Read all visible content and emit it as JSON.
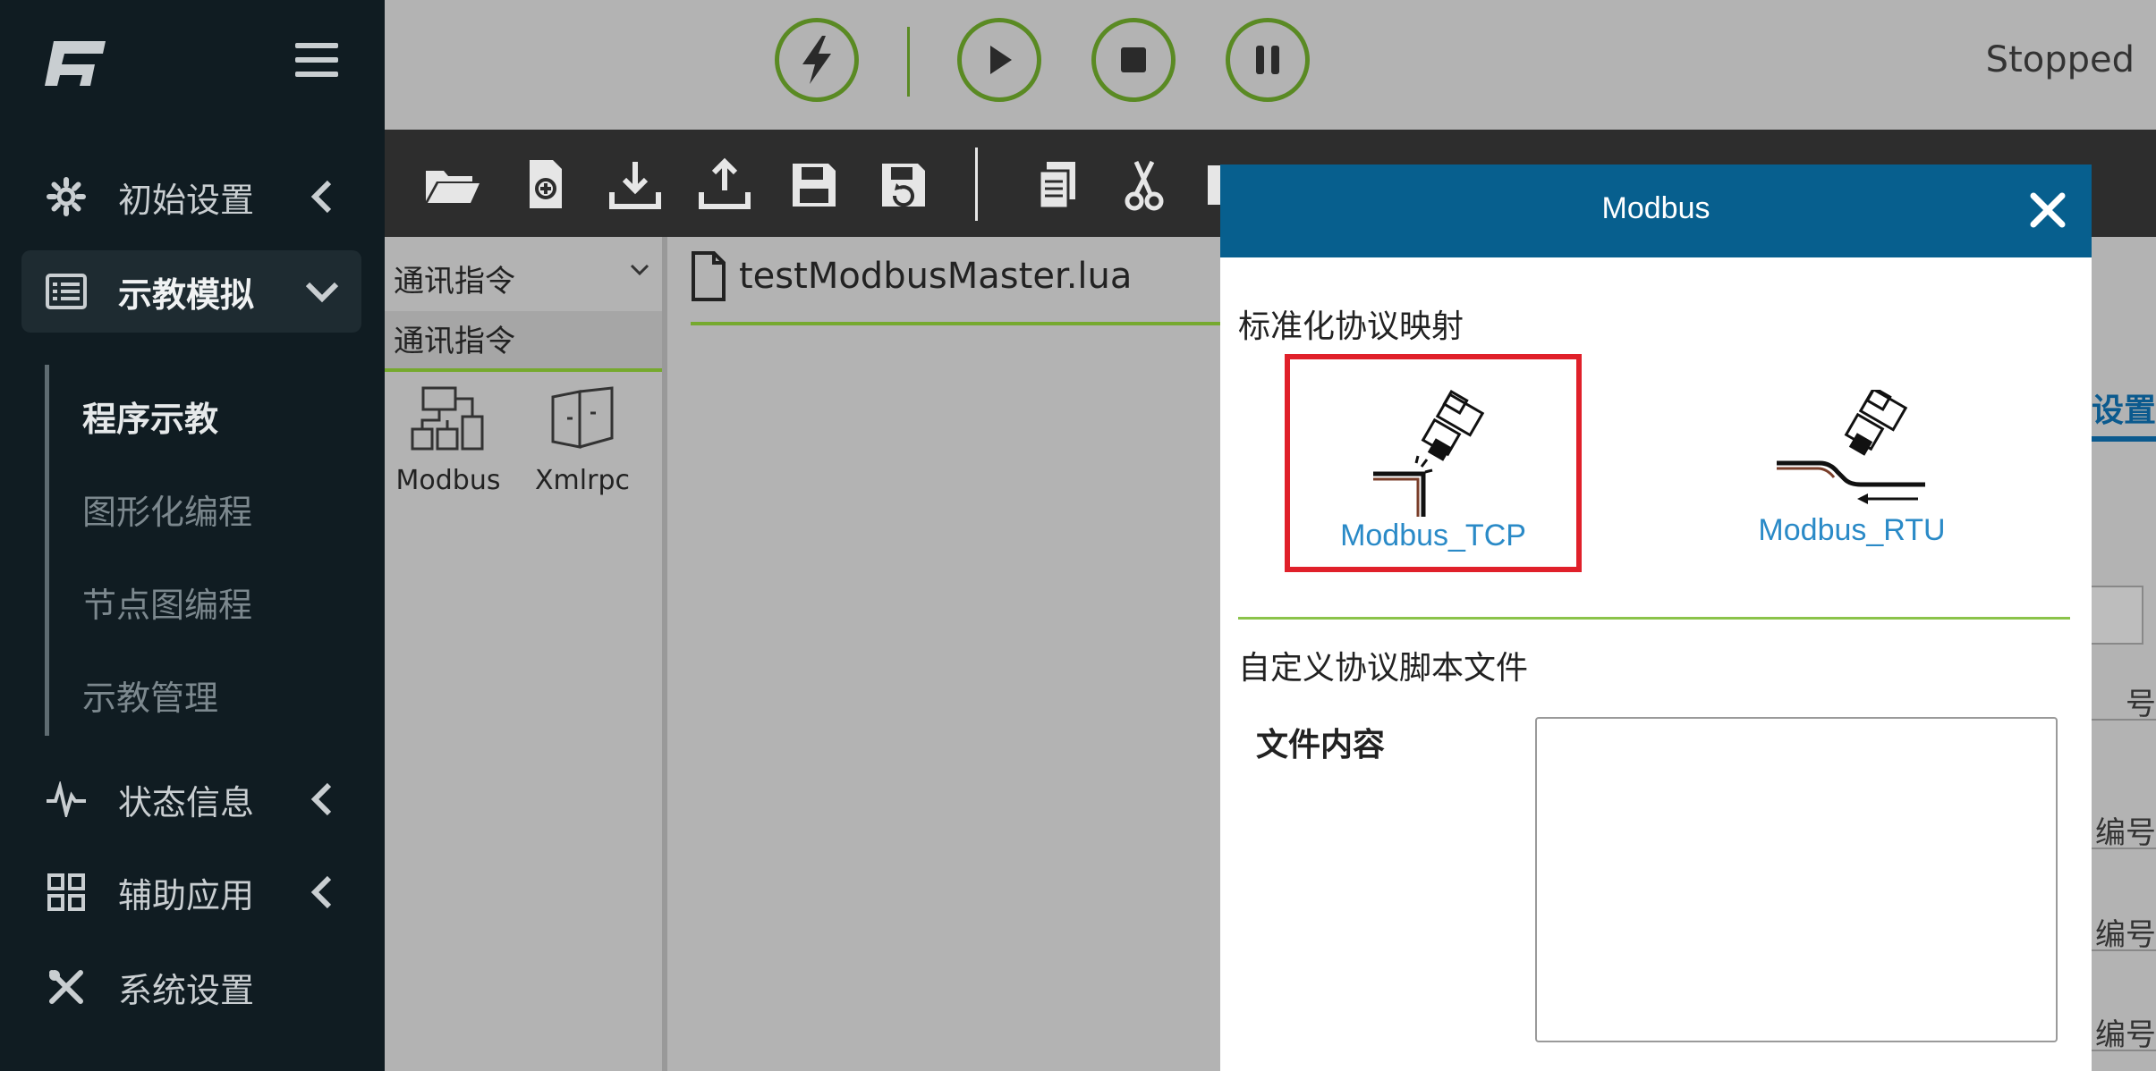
{
  "sidebar": {
    "logo_icon": "fr-logo",
    "menu_icon": "hamburger-icon",
    "items": [
      {
        "label": "初始设置",
        "icon": "gear-icon",
        "chevron": "chevron-left-icon"
      },
      {
        "label": "示教模拟",
        "icon": "list-icon",
        "chevron": "chevron-down-icon"
      },
      {
        "label": "状态信息",
        "icon": "pulse-icon",
        "chevron": "chevron-left-icon"
      },
      {
        "label": "辅助应用",
        "icon": "grid-icon",
        "chevron": "chevron-left-icon"
      },
      {
        "label": "系统设置",
        "icon": "tools-icon"
      }
    ],
    "subitems": [
      "程序示教",
      "图形化编程",
      "节点图编程",
      "示教管理"
    ],
    "active_sub": "程序示教"
  },
  "topbar": {
    "buttons": [
      "power-icon",
      "play-icon",
      "stop-icon",
      "pause-icon"
    ],
    "status": "Stopped",
    "accent": "#5a8a23"
  },
  "toolbar": {
    "tools": [
      "open-folder-icon",
      "new-file-icon",
      "download-icon",
      "upload-icon",
      "save-icon",
      "save-as-icon",
      "copy-icon",
      "cut-icon",
      "paste-icon"
    ]
  },
  "left_panel": {
    "select_value": "通讯指令",
    "header": "通讯指令",
    "commands": [
      {
        "label": "Modbus",
        "icon": "modbus-icon"
      },
      {
        "label": "Xmlrpc",
        "icon": "xmlrpc-icon"
      }
    ]
  },
  "editor": {
    "filename": "testModbusMaster.lua"
  },
  "background_partial": {
    "tab_fragment": "站设置",
    "labels": [
      "号",
      "编号",
      "编号",
      "编号"
    ]
  },
  "modal": {
    "title": "Modbus",
    "header_color": "#075f8e",
    "section1": "标准化协议映射",
    "protocols": [
      {
        "label": "Modbus_TCP",
        "selected": true
      },
      {
        "label": "Modbus_RTU",
        "selected": false
      }
    ],
    "section2": "自定义协议脚本文件",
    "file_label": "文件内容",
    "file_value": ""
  }
}
